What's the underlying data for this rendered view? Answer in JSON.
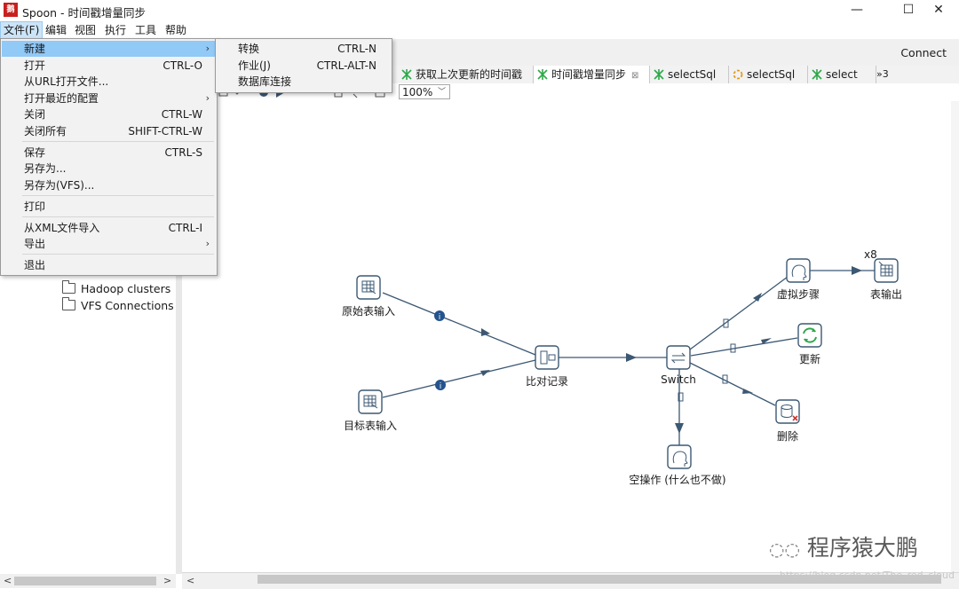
{
  "window": {
    "title": "Spoon - 时间戳增量同步",
    "icon_text": "鹅",
    "min_glyph": "—",
    "max_glyph": "☐",
    "close_glyph": "✕"
  },
  "menubar": [
    "文件(F)",
    "编辑",
    "视图",
    "执行",
    "工具",
    "帮助"
  ],
  "toolbar": {
    "connect_label": "Connect"
  },
  "file_menu": {
    "items": [
      {
        "label": "新建",
        "shortcut": "",
        "submenu": true
      },
      {
        "label": "打开",
        "shortcut": "CTRL-O",
        "submenu": false
      },
      {
        "label": "从URL打开文件...",
        "shortcut": "",
        "submenu": false
      },
      {
        "label": "打开最近的配置",
        "shortcut": "",
        "submenu": true
      },
      {
        "label": "关闭",
        "shortcut": "CTRL-W",
        "submenu": false
      },
      {
        "label": "关闭所有",
        "shortcut": "SHIFT-CTRL-W",
        "submenu": false
      },
      {
        "label": "保存",
        "shortcut": "CTRL-S",
        "submenu": false
      },
      {
        "label": "另存为...",
        "shortcut": "",
        "submenu": false
      },
      {
        "label": "另存为(VFS)...",
        "shortcut": "",
        "submenu": false
      },
      {
        "label": "打印",
        "shortcut": "",
        "submenu": false
      },
      {
        "label": "从XML文件导入",
        "shortcut": "CTRL-I",
        "submenu": false
      },
      {
        "label": "导出",
        "shortcut": "",
        "submenu": true
      },
      {
        "label": "退出",
        "shortcut": "",
        "submenu": false
      }
    ]
  },
  "new_submenu": {
    "items": [
      {
        "label": "转换",
        "shortcut": "CTRL-N"
      },
      {
        "label": "作业(J)",
        "shortcut": "CTRL-ALT-N"
      },
      {
        "label": "数据库连接",
        "shortcut": ""
      }
    ]
  },
  "tree": {
    "items": [
      "Hadoop clusters",
      "VFS Connections"
    ]
  },
  "tabs": [
    {
      "label": "获取上次更新的时间戳",
      "active": false,
      "icon": "transformation-icon"
    },
    {
      "label": "时间戳增量同步",
      "active": true,
      "icon": "transformation-icon",
      "close": "⊠"
    },
    {
      "label": "selectSql",
      "active": false,
      "icon": "transformation-icon"
    },
    {
      "label": "selectSql",
      "active": false,
      "icon": "job-icon"
    },
    {
      "label": "select",
      "active": false,
      "icon": "transformation-icon"
    },
    {
      "label": "»3",
      "active": false,
      "icon": "overflow-icon"
    }
  ],
  "zoom": {
    "value": "100%"
  },
  "diagram": {
    "nodes": [
      {
        "id": "source",
        "label": "原始表输入",
        "icon": "table-input-icon"
      },
      {
        "id": "target",
        "label": "目标表输入",
        "icon": "table-input-icon"
      },
      {
        "id": "merge",
        "label": "比对记录",
        "icon": "merge-rows-icon"
      },
      {
        "id": "switch",
        "label": "Switch",
        "icon": "switch-case-icon"
      },
      {
        "id": "dummy1",
        "label": "虚拟步骤",
        "icon": "dummy-icon"
      },
      {
        "id": "output",
        "label": "表输出",
        "icon": "table-output-icon",
        "copies": "x8"
      },
      {
        "id": "update",
        "label": "更新",
        "icon": "update-icon"
      },
      {
        "id": "delete",
        "label": "删除",
        "icon": "delete-icon"
      },
      {
        "id": "dummy2",
        "label": "空操作 (什么也不做)",
        "icon": "dummy-icon"
      }
    ],
    "info_glyph": "i"
  },
  "watermark": {
    "text": "程序猿大鹏",
    "url": "https://blog.csdn.net/The_red_cloud"
  },
  "colors": {
    "accent": "#91c9f7",
    "hop": "#3c5873",
    "icon_stroke": "#3c5873",
    "update_green": "#2ea84a",
    "delete_red": "#d0352f"
  }
}
